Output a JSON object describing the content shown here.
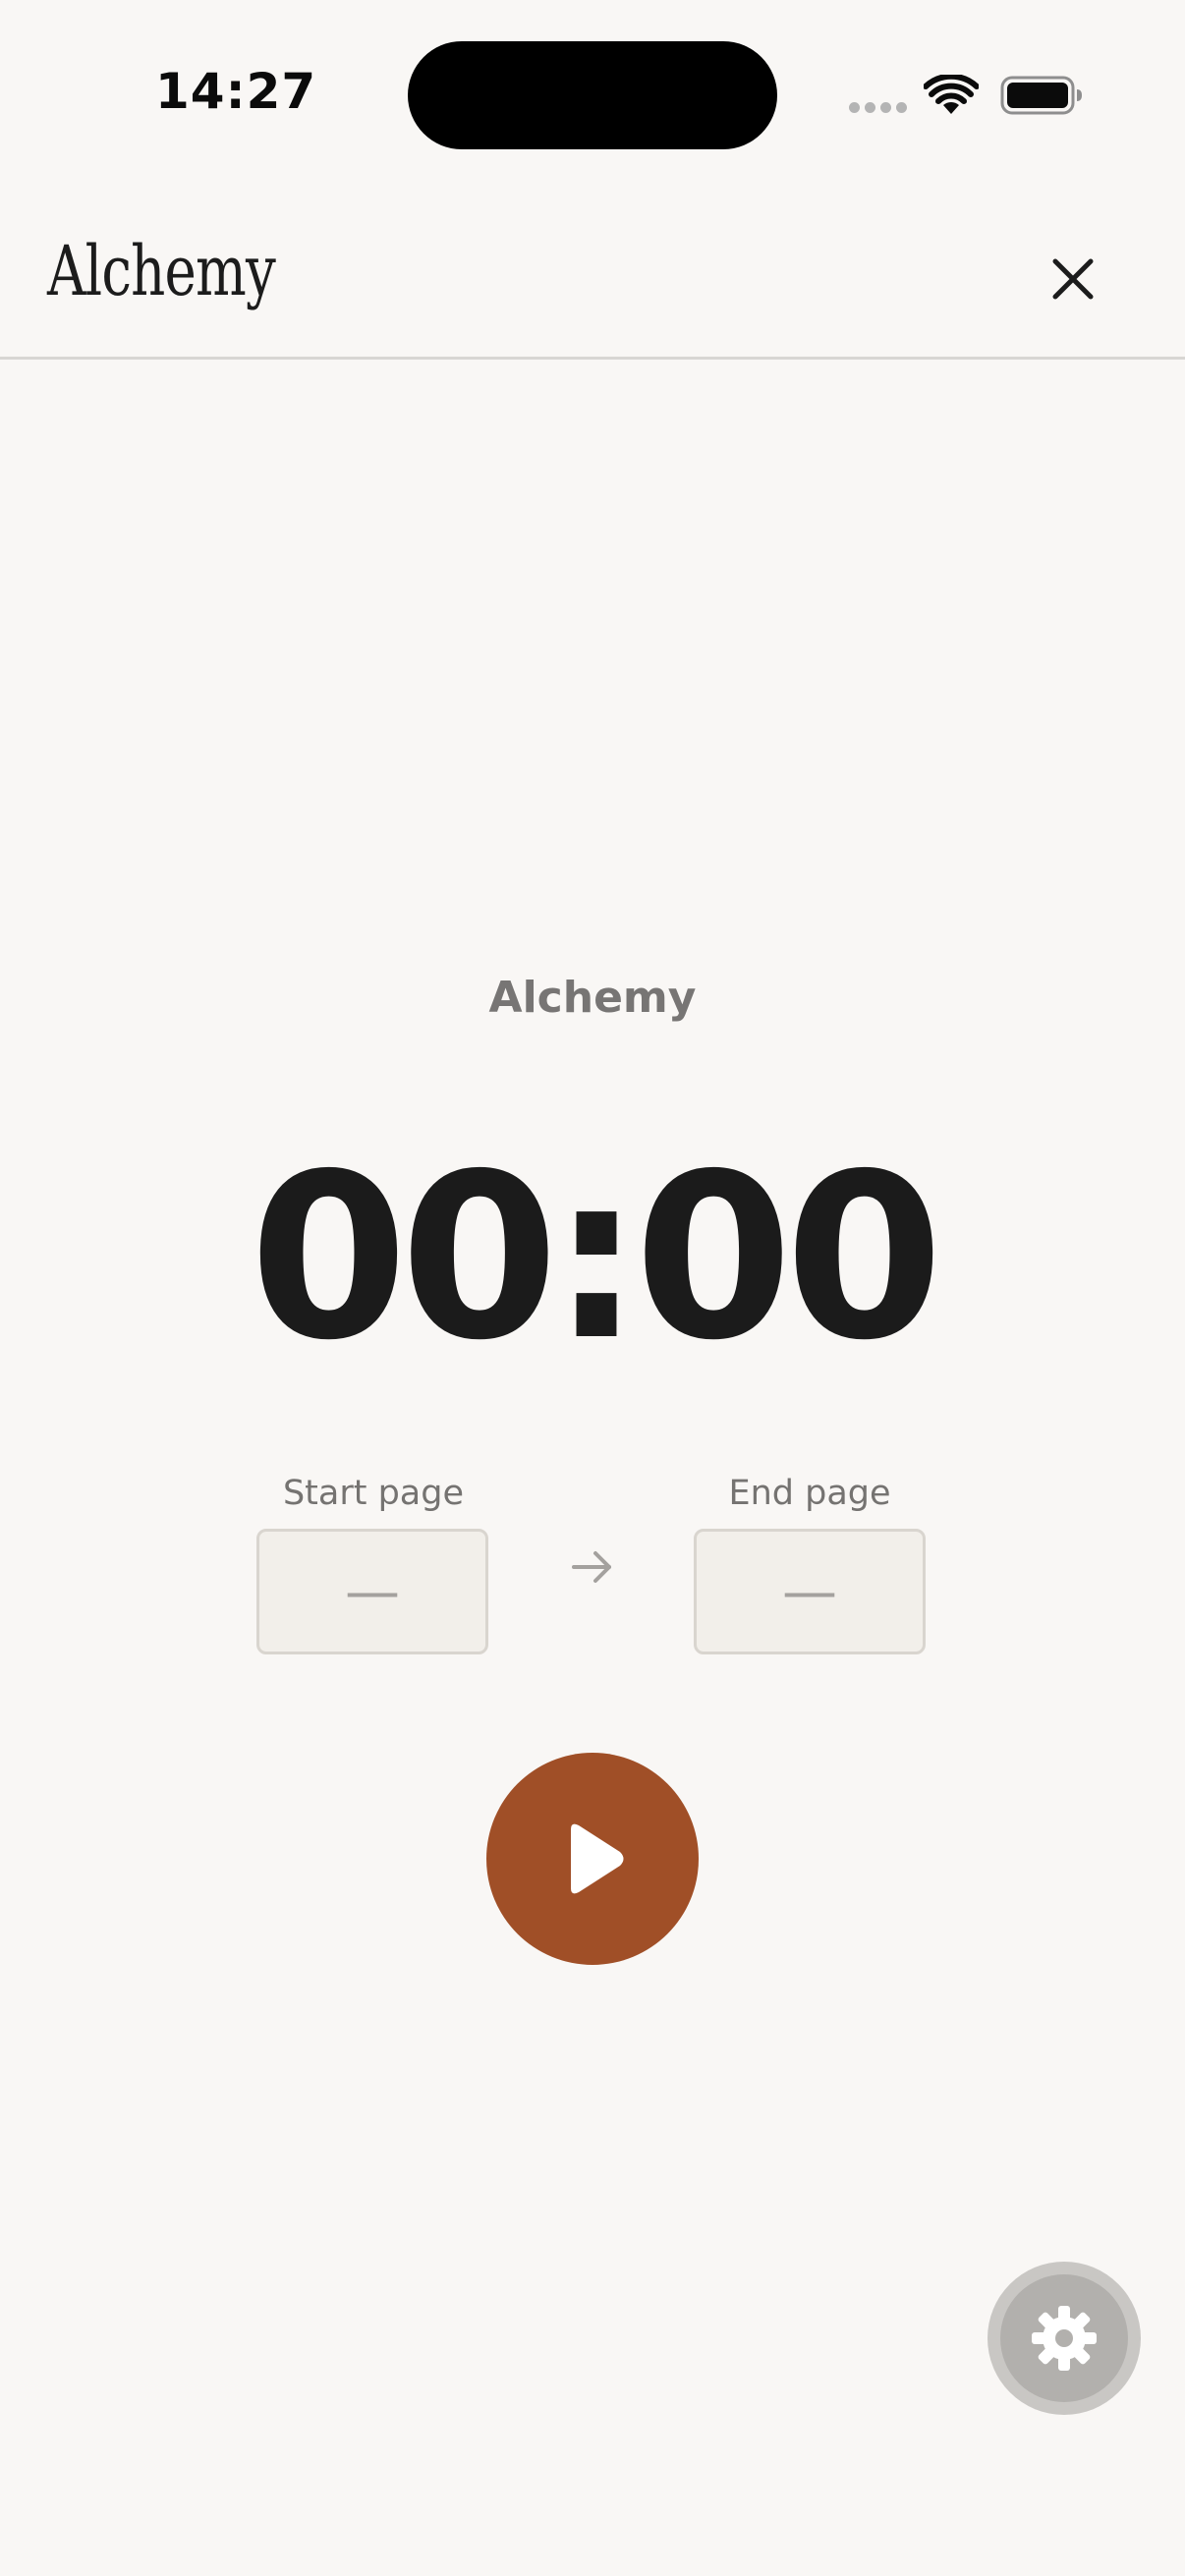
{
  "status_bar": {
    "time": "14:27"
  },
  "header": {
    "title": "Alchemy",
    "close_icon": "close-icon"
  },
  "session": {
    "book_title": "Alchemy",
    "timer": "00:00",
    "start_page_label": "Start page",
    "start_page_value": "—",
    "end_page_label": "End page",
    "end_page_value": "—"
  },
  "icons": {
    "arrow": "arrow-right-icon",
    "play": "play-icon",
    "settings": "gear-icon"
  },
  "colors": {
    "background": "#f9f7f5",
    "accent": "#a04f27",
    "text_primary": "#1b1b1b",
    "text_secondary": "#777574"
  }
}
